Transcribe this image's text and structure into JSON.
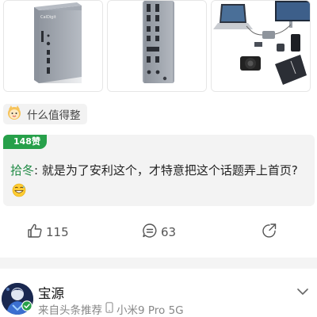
{
  "gallery": {
    "images": [
      {
        "name": "dock-front-photo",
        "alt": "CalDigit"
      },
      {
        "name": "dock-back-photo"
      },
      {
        "name": "dock-setup-photo"
      }
    ]
  },
  "source_tag": {
    "icon": "cartoon-mascot-icon",
    "label": "什么值得整"
  },
  "hot_comment": {
    "likes_badge": "148赞",
    "author": "拾冬",
    "separator": ": ",
    "text": "就是为了安利这个，才特意把这个话题弄上首页?",
    "emoji": "grinning-sweat-emoji",
    "author_color": "#1f8a44",
    "badge_color": "#27a04a"
  },
  "actions": {
    "like_count": "115",
    "comment_count": "63",
    "like_icon": "thumbs-up-icon",
    "comment_icon": "comment-icon",
    "share_icon": "share-icon"
  },
  "next_post": {
    "username": "宝源",
    "source": "来自头条推荐",
    "device": "小米9 Pro 5G",
    "verified_color": "#27a04a"
  }
}
